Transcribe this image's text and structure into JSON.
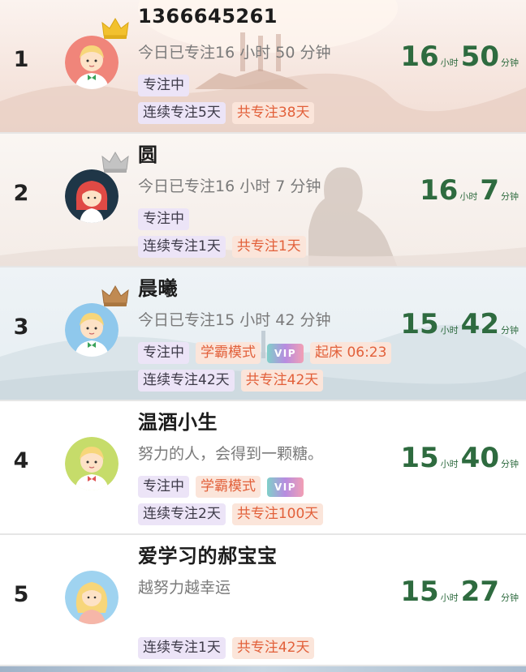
{
  "rows": [
    {
      "rank": "1",
      "name": "1366645261",
      "subtitle": "今日已专注16 小时 50 分钟",
      "tags_top": [
        {
          "text": "专注中",
          "style": "purple"
        }
      ],
      "tags_bottom": [
        {
          "text": "连续专注5天",
          "style": "purple"
        },
        {
          "text": "共专注38天",
          "style": "orange"
        }
      ],
      "hours": "16",
      "hours_unit": "小时",
      "minutes": "50",
      "minutes_unit": "分钟",
      "crown_color": "#f2c12e",
      "avatar": "boy-avatar-red"
    },
    {
      "rank": "2",
      "name": "圆",
      "subtitle": "今日已专注16 小时 7 分钟",
      "tags_top": [
        {
          "text": "专注中",
          "style": "purple"
        }
      ],
      "tags_bottom": [
        {
          "text": "连续专注1天",
          "style": "purple"
        },
        {
          "text": "共专注1天",
          "style": "orange"
        }
      ],
      "hours": "16",
      "hours_unit": "小时",
      "minutes": "7",
      "minutes_unit": "分钟",
      "crown_color": "#b8b8b8",
      "avatar": "girl-avatar-dark"
    },
    {
      "rank": "3",
      "name": "晨曦",
      "subtitle": "今日已专注15 小时 42 分钟",
      "tags_top": [
        {
          "text": "专注中",
          "style": "purple"
        },
        {
          "text": "学霸模式",
          "style": "orange"
        },
        {
          "text": "VIP",
          "style": "vip"
        },
        {
          "text": "起床 06:23",
          "style": "orange"
        }
      ],
      "tags_bottom": [
        {
          "text": "连续专注42天",
          "style": "purple"
        },
        {
          "text": "共专注42天",
          "style": "orange"
        }
      ],
      "hours": "15",
      "hours_unit": "小时",
      "minutes": "42",
      "minutes_unit": "分钟",
      "crown_color": "#c08a52",
      "avatar": "boy-avatar-blue"
    },
    {
      "rank": "4",
      "name": "温酒小生",
      "subtitle": "努力的人，会得到一颗糖。",
      "tags_top": [
        {
          "text": "专注中",
          "style": "purple"
        },
        {
          "text": "学霸模式",
          "style": "orange"
        },
        {
          "text": "VIP",
          "style": "vip"
        }
      ],
      "tags_bottom": [
        {
          "text": "连续专注2天",
          "style": "purple"
        },
        {
          "text": "共专注100天",
          "style": "orange"
        }
      ],
      "hours": "15",
      "hours_unit": "小时",
      "minutes": "40",
      "minutes_unit": "分钟",
      "crown_color": "",
      "avatar": "boy-avatar-green"
    },
    {
      "rank": "5",
      "name": "爱学习的郝宝宝",
      "subtitle": "越努力越幸运",
      "tags_top": [],
      "tags_bottom": [
        {
          "text": "连续专注1天",
          "style": "purple"
        },
        {
          "text": "共专注42天",
          "style": "orange"
        }
      ],
      "hours": "15",
      "hours_unit": "小时",
      "minutes": "27",
      "minutes_unit": "分钟",
      "crown_color": "",
      "avatar": "girl-avatar-blue"
    }
  ],
  "colors": {
    "time_green": "#2e6b3f",
    "tag_purple_bg": "#ece4f7",
    "tag_orange_bg": "#fbe5da",
    "tag_orange_text": "#e2603a"
  }
}
